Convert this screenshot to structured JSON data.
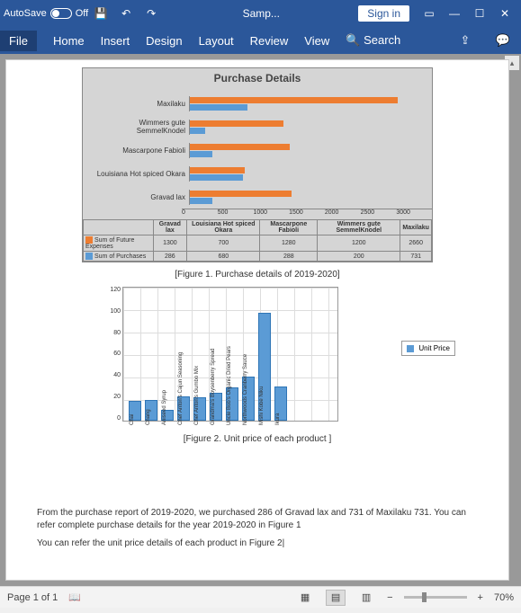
{
  "titlebar": {
    "autosave": "AutoSave",
    "off": "Off",
    "filename": "Samp...",
    "signin": "Sign in"
  },
  "ribbon": {
    "file": "File",
    "home": "Home",
    "insert": "Insert",
    "design": "Design",
    "layout": "Layout",
    "review": "Review",
    "view": "View",
    "search": "Search"
  },
  "caption1": "[Figure 1. Purchase details of 2019-2020]",
  "caption2": "[Figure 2. Unit price of each product ]",
  "para1": "From the purchase report of 2019-2020, we purchased 286 of Gravad lax and 731 of Maxilaku 731. You can refer complete purchase details for the year 2019-2020 in Figure 1",
  "para2": "You can refer the unit price details of each product in Figure 2|",
  "status": {
    "page": "Page 1 of 1",
    "zoom": "70%"
  },
  "chart_data": [
    {
      "type": "bar",
      "title": "Purchase Details",
      "orientation": "horizontal",
      "categories": [
        "Maxilaku",
        "Wimmers gute SemmelKnodel",
        "Mascarpone Fabioli",
        "Louisiana Hot spiced Okara",
        "Gravad lax"
      ],
      "series": [
        {
          "name": "Sum of Future Expenses",
          "color": "#ed7d31",
          "values": [
            2660,
            1200,
            1280,
            700,
            1300
          ]
        },
        {
          "name": "Sum of Purchases",
          "color": "#5b9bd5",
          "values": [
            731,
            200,
            288,
            680,
            286
          ]
        }
      ],
      "xlim": [
        0,
        3000
      ],
      "xticks": [
        0,
        500,
        1000,
        1500,
        2000,
        2500,
        3000
      ],
      "table_cols": [
        "Gravad lax",
        "Louisiana Hot spiced Okara",
        "Mascarpone Fabioli",
        "Wimmers gute SemmelKnodel",
        "Maxilaku"
      ],
      "table_rows": [
        {
          "label": "Sum of Future Expenses",
          "values": [
            1300,
            700,
            1280,
            1200,
            2660
          ]
        },
        {
          "label": "Sum of Purchases",
          "values": [
            286,
            680,
            288,
            200,
            731
          ]
        }
      ]
    },
    {
      "type": "bar",
      "legend": "Unit Price",
      "ylim": [
        0,
        120
      ],
      "yticks": [
        0,
        20,
        40,
        60,
        80,
        100,
        120
      ],
      "categories": [
        "Chai",
        "Chang",
        "Aniseed Syrup",
        "Chef Anton's Cajun Seasoning",
        "Chef Anton's Gumbo Mix",
        "Grandma's Boysenberry Spread",
        "Uncle Bob's Organic Dried Pears",
        "Northwoods Cranberry Sauce",
        "Mishi Kobe Niku",
        "Ikura"
      ],
      "values": [
        18,
        19,
        10,
        22,
        21,
        25,
        30,
        40,
        97,
        31
      ]
    }
  ]
}
